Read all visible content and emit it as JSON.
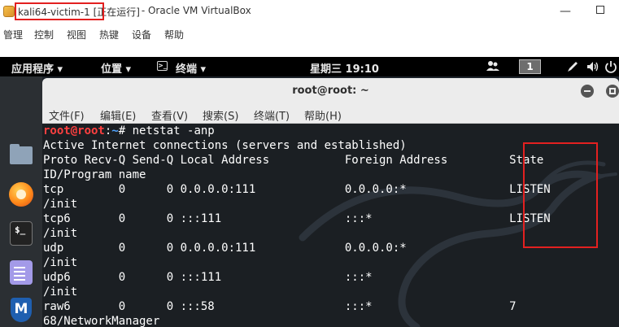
{
  "vbox": {
    "title_machine": "kali64-victim-1 [正在运行]",
    "title_rest": " - Oracle VM VirtualBox",
    "menu": [
      "管理",
      "控制",
      "视图",
      "热键",
      "设备",
      "帮助"
    ],
    "minimize_glyph": "—"
  },
  "guest_topbar": {
    "apps": "应用程序 ▾",
    "places": "位置 ▾",
    "terminal_icon": ">_",
    "terminal": "终端 ▾",
    "clock": "星期三 19:10",
    "workspace": "1"
  },
  "dock": {
    "terminal_glyph": "$_",
    "metasploit_glyph": "M"
  },
  "terminal": {
    "title": "root@root: ~",
    "menu": [
      "文件(F)",
      "编辑(E)",
      "查看(V)",
      "搜索(S)",
      "终端(T)",
      "帮助(H)"
    ],
    "prompt_user": "root@root",
    "prompt_sep": ":",
    "prompt_path": "~",
    "prompt_end": "# ",
    "command": "netstat -anp",
    "lines": [
      "Active Internet connections (servers and established)",
      "Proto Recv-Q Send-Q Local Address           Foreign Address         State",
      "ID/Program name",
      "tcp        0      0 0.0.0.0:111             0.0.0.0:*               LISTEN",
      "/init",
      "tcp6       0      0 :::111                  :::*                    LISTEN",
      "/init",
      "udp        0      0 0.0.0.0:111             0.0.0.0:*",
      "/init",
      "udp6       0      0 :::111                  :::*",
      "/init",
      "raw6       0      0 :::58                   :::*                    7",
      "68/NetworkManager"
    ]
  },
  "colors": {
    "prompt_user": "#ff4040",
    "prompt_path": "#4fa3ff",
    "highlight": "#e32020",
    "terminal_bg": "#1b1f23"
  },
  "icons": {
    "titlebar": "virtualbox-app-icon",
    "topbar_system": [
      "people-icon",
      "pen-icon",
      "volume-icon",
      "power-icon"
    ],
    "dock": [
      "files-icon",
      "firefox-icon",
      "terminal-icon",
      "text-editor-icon",
      "metasploit-icon"
    ]
  }
}
